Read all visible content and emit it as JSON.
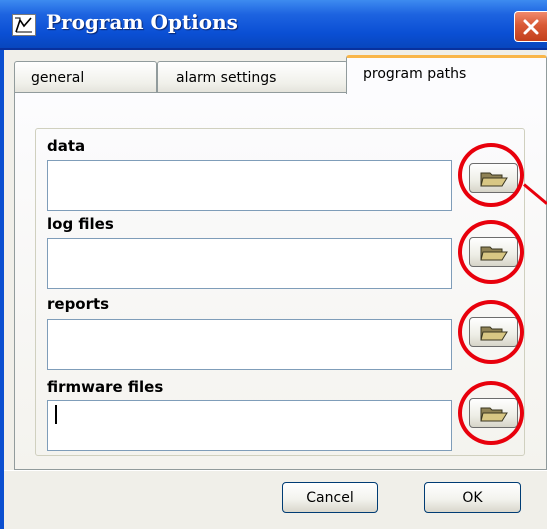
{
  "window": {
    "title": "Program Options",
    "close_icon": "close-icon",
    "app_icon": "app-icon"
  },
  "tabs": [
    {
      "label": "general",
      "active": false
    },
    {
      "label": "alarm settings",
      "active": false
    },
    {
      "label": "program paths",
      "active": true
    }
  ],
  "fields": [
    {
      "label": "data",
      "value": "",
      "browse_icon": "folder-open-icon"
    },
    {
      "label": "log files",
      "value": "",
      "browse_icon": "folder-open-icon"
    },
    {
      "label": "reports",
      "value": "",
      "browse_icon": "folder-open-icon"
    },
    {
      "label": "firmware files",
      "value": "",
      "browse_icon": "folder-open-icon",
      "focused": true
    }
  ],
  "annotations": {
    "highlight_color": "#e8000c",
    "shape": "circle"
  },
  "buttons": {
    "cancel": "Cancel",
    "ok": "OK"
  },
  "colors": {
    "titlebar": "#0a4fd4",
    "active_tab_accent": "#f9b64a",
    "dialog_bg": "#ece9d8",
    "input_border": "#7f9db9"
  }
}
